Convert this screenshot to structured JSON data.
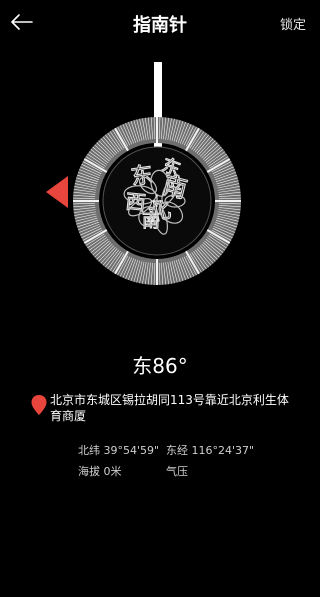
{
  "header": {
    "title": "指南针",
    "lock_label": "锁定"
  },
  "compass": {
    "heading_text": "东86°",
    "dial_glyphs": [
      "东",
      "南",
      "西",
      "北",
      "东",
      "南"
    ],
    "accent_color": "#e8453c"
  },
  "location": {
    "address": "北京市东城区锡拉胡同113号靠近北京利生体育商厦",
    "latitude_label": "北纬 39°54'59\"",
    "longitude_label": "东经 116°24'37\"",
    "altitude_label": "海拔 0米",
    "pressure_label": "气压"
  }
}
